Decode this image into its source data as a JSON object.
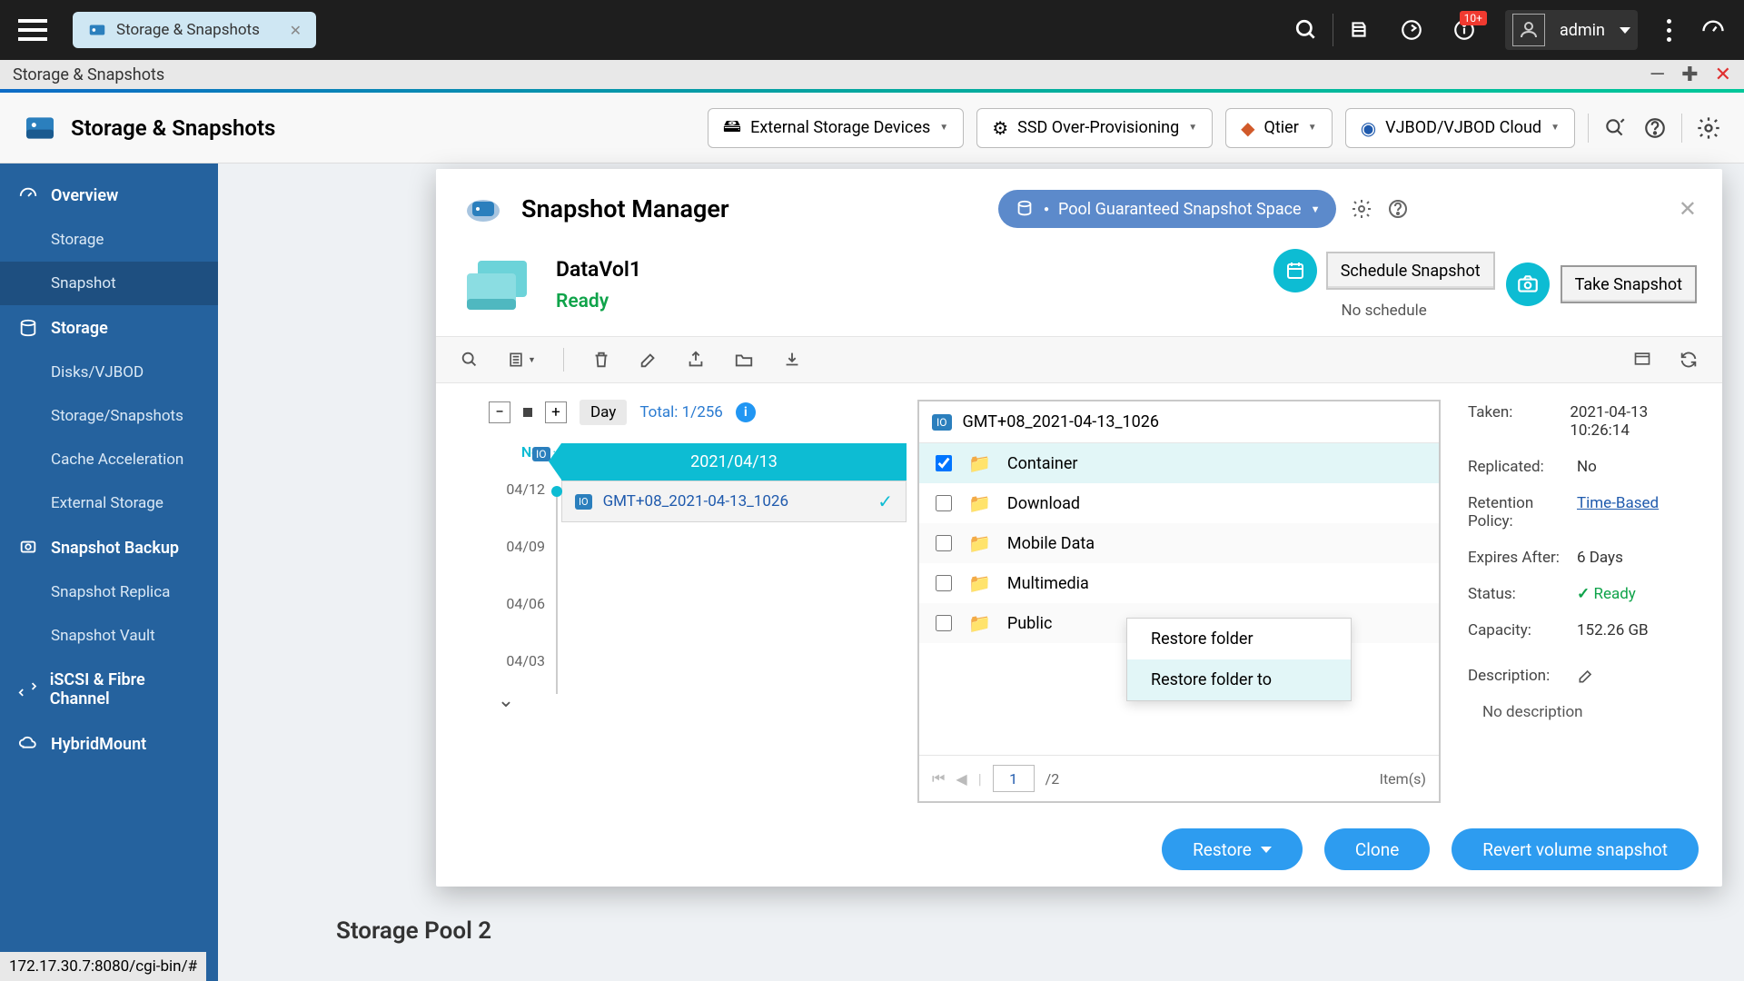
{
  "os": {
    "tab_title": "Storage & Snapshots",
    "notif_count": "10+",
    "username": "admin"
  },
  "window": {
    "title": "Storage & Snapshots",
    "brand": "Storage & Snapshots",
    "combo1": "External Storage Devices",
    "combo2": "SSD Over-Provisioning",
    "combo3": "Qtier",
    "combo4": "VJBOD/VJBOD Cloud"
  },
  "sidebar": {
    "overview": "Overview",
    "s_storage": "Storage",
    "s_snapshot": "Snapshot",
    "storage_h": "Storage",
    "disks": "Disks/VJBOD",
    "pools": "Storage/Snapshots",
    "cache": "Cache Acceleration",
    "ext": "External Storage",
    "backup_h": "Snapshot Backup",
    "replica": "Snapshot Replica",
    "vault": "Snapshot Vault",
    "iscsi": "iSCSI & Fibre Channel",
    "hybrid": "HybridMount"
  },
  "modal": {
    "title": "Snapshot Manager",
    "pool_pill": "Pool Guaranteed Snapshot Space",
    "vol_name": "DataVol1",
    "vol_state": "Ready",
    "sched_btn": "Schedule Snapshot",
    "take_btn": "Take Snapshot",
    "sched_note": "No schedule",
    "day": "Day",
    "total": "Total: 1/256",
    "now": "Now",
    "d1": "04/12",
    "d2": "04/09",
    "d3": "04/06",
    "d4": "04/03",
    "marker": ":1",
    "date_hdr": "2021/04/13",
    "snap_name": "GMT+08_2021-04-13_1026",
    "br_hdr": "GMT+08_2021-04-13_1026",
    "folders": [
      "Container",
      "Download",
      "Mobile Data",
      "Multimedia",
      "Public"
    ],
    "pager_page": "1",
    "pager_of": "/2",
    "pager_items": "Item(s)",
    "ctx1": "Restore folder",
    "ctx2": "Restore folder to",
    "det_taken_l": "Taken:",
    "det_taken_v": "2021-04-13 10:26:14",
    "det_rep_l": "Replicated:",
    "det_rep_v": "No",
    "det_ret_l": "Retention Policy:",
    "det_ret_v": "Time-Based",
    "det_exp_l": "Expires After:",
    "det_exp_v": "6 Days",
    "det_stat_l": "Status:",
    "det_stat_v": "Ready",
    "det_cap_l": "Capacity:",
    "det_cap_v": "152.26 GB",
    "det_desc_l": "Description:",
    "det_desc_v": "No description",
    "btn_restore": "Restore",
    "btn_clone": "Clone",
    "btn_revert": "Revert volume snapshot"
  },
  "bg": {
    "pool": "Storage Pool 2",
    "url": "172.17.30.7:8080/cgi-bin/#"
  }
}
